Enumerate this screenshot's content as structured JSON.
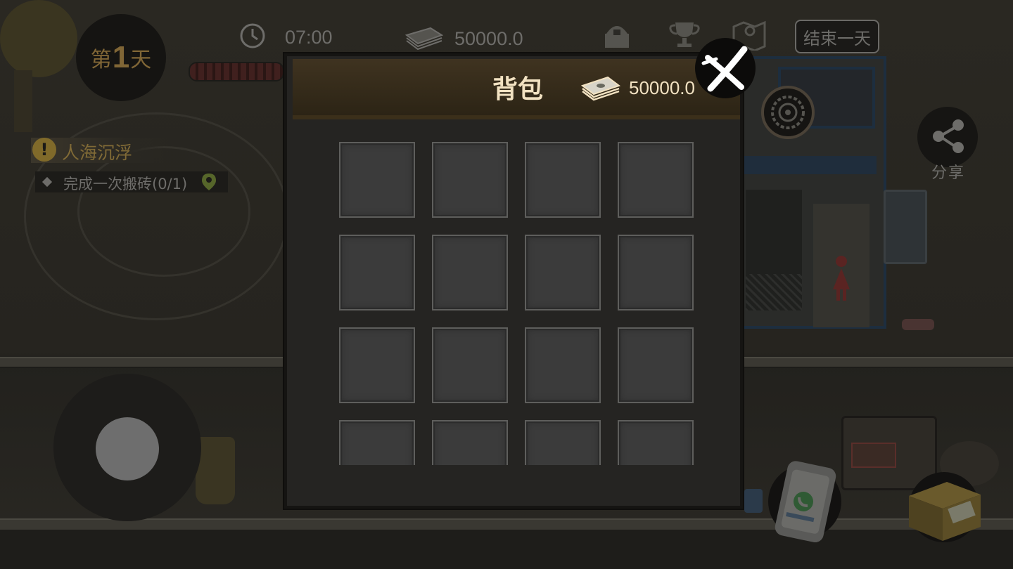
{
  "hud": {
    "day_prefix": "第",
    "day_number": "1",
    "day_suffix": "天",
    "time": "07:00",
    "money": "50000.0",
    "end_day_label": "结束一天",
    "share_label": "分享"
  },
  "quest": {
    "title": "人海沉浮",
    "step": "完成一次搬砖(0/1)"
  },
  "inventory": {
    "title": "背包",
    "money": "50000.0",
    "slots": [
      {
        "item": ""
      },
      {
        "item": ""
      },
      {
        "item": ""
      },
      {
        "item": ""
      },
      {
        "item": ""
      },
      {
        "item": ""
      },
      {
        "item": ""
      },
      {
        "item": ""
      },
      {
        "item": ""
      },
      {
        "item": ""
      },
      {
        "item": ""
      },
      {
        "item": ""
      },
      {
        "item": ""
      },
      {
        "item": ""
      },
      {
        "item": ""
      },
      {
        "item": ""
      }
    ]
  },
  "icons": {
    "clock": "clock-icon",
    "cash": "cash-stack-icon",
    "store": "shop-icon",
    "trophy": "trophy-icon",
    "map": "map-icon",
    "close": "close-icon",
    "settings": "gear-icon",
    "share": "share-icon",
    "phone": "phone-icon",
    "express": "package-icon"
  },
  "colors": {
    "accent_gold": "#806636",
    "panel_header": "#3f3320",
    "slot_fill": "#3b3b3b",
    "text_light": "#f2e2c2"
  }
}
